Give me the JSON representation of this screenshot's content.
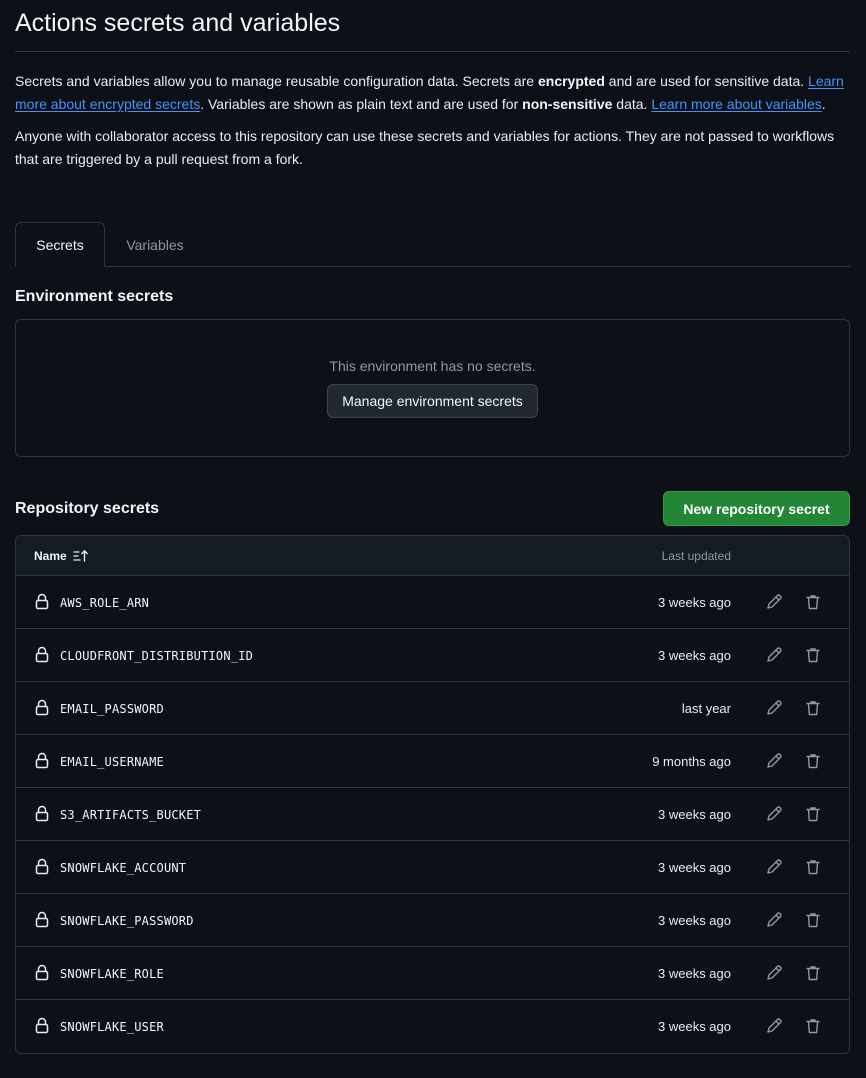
{
  "page": {
    "title": "Actions secrets and variables"
  },
  "intro": {
    "p1_a": "Secrets and variables allow you to manage reusable configuration data. Secrets are ",
    "p1_b": "encrypted",
    "p1_c": " and are used for sensitive data. ",
    "link_secrets": "Learn more about encrypted secrets",
    "p1_d": ". Variables are shown as plain text and are used for ",
    "p1_e": "non-sensitive",
    "p1_f": " data. ",
    "link_variables": "Learn more about variables",
    "p1_g": ".",
    "p2": "Anyone with collaborator access to this repository can use these secrets and variables for actions. They are not passed to workflows that are triggered by a pull request from a fork."
  },
  "tabs": {
    "secrets": "Secrets",
    "variables": "Variables",
    "active": "Secrets"
  },
  "environment": {
    "heading": "Environment secrets",
    "empty_text": "This environment has no secrets.",
    "manage_button": "Manage environment secrets"
  },
  "repository": {
    "heading": "Repository secrets",
    "new_button": "New repository secret",
    "columns": {
      "name": "Name",
      "updated": "Last updated"
    },
    "secrets": [
      {
        "name": "AWS_ROLE_ARN",
        "updated": "3 weeks ago"
      },
      {
        "name": "CLOUDFRONT_DISTRIBUTION_ID",
        "updated": "3 weeks ago"
      },
      {
        "name": "EMAIL_PASSWORD",
        "updated": "last year"
      },
      {
        "name": "EMAIL_USERNAME",
        "updated": "9 months ago"
      },
      {
        "name": "S3_ARTIFACTS_BUCKET",
        "updated": "3 weeks ago"
      },
      {
        "name": "SNOWFLAKE_ACCOUNT",
        "updated": "3 weeks ago"
      },
      {
        "name": "SNOWFLAKE_PASSWORD",
        "updated": "3 weeks ago"
      },
      {
        "name": "SNOWFLAKE_ROLE",
        "updated": "3 weeks ago"
      },
      {
        "name": "SNOWFLAKE_USER",
        "updated": "3 weeks ago"
      }
    ]
  },
  "icons": {
    "lock": "lock-icon",
    "edit": "pencil-icon",
    "delete": "trash-icon",
    "sort": "sort-ascending-icon"
  },
  "colors": {
    "background": "#0d1117",
    "border": "#30363d",
    "link": "#4493f8",
    "primary_button": "#238636",
    "muted_text": "#9198a1"
  }
}
